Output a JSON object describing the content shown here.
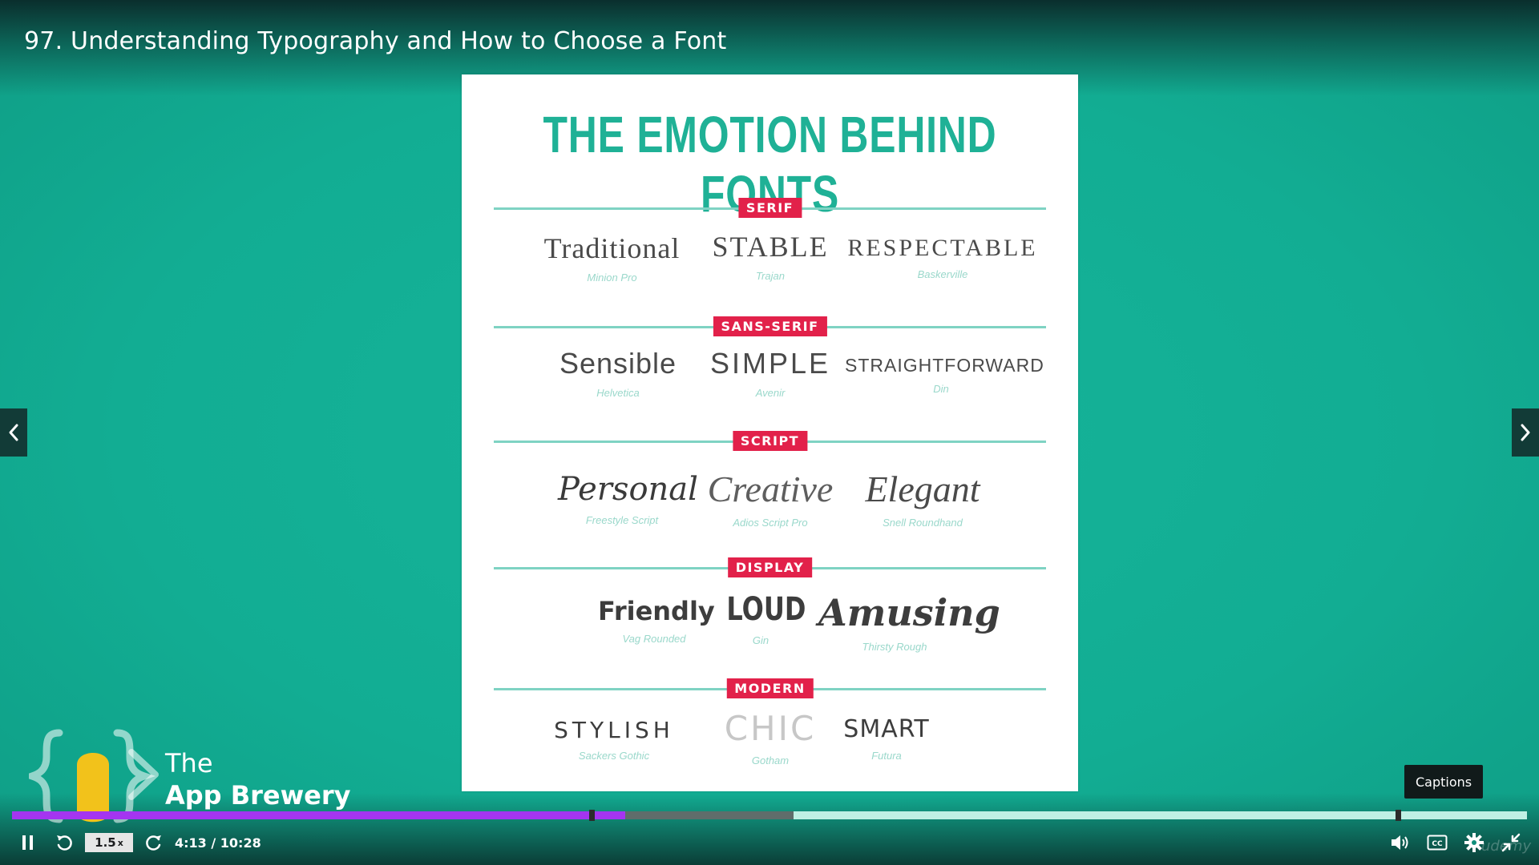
{
  "lecture": {
    "title": "97. Understanding Typography and How to Choose a Font"
  },
  "slide": {
    "heading": "THE EMOTION BEHIND FONTS",
    "sections": [
      {
        "badge": "SERIF",
        "items": [
          {
            "word": "Traditional",
            "font": "Minion Pro"
          },
          {
            "word": "STABLE",
            "font": "Trajan"
          },
          {
            "word": "RESPECTABLE",
            "font": "Baskerville"
          }
        ]
      },
      {
        "badge": "SANS-SERIF",
        "items": [
          {
            "word": "Sensible",
            "font": "Helvetica"
          },
          {
            "word": "SIMPLE",
            "font": "Avenir"
          },
          {
            "word": "STRAIGHTFORWARD",
            "font": "Din"
          }
        ]
      },
      {
        "badge": "SCRIPT",
        "items": [
          {
            "word": "Personal",
            "font": "Freestyle Script"
          },
          {
            "word": "Creative",
            "font": "Adios Script Pro"
          },
          {
            "word": "Elegant",
            "font": "Snell Roundhand"
          }
        ]
      },
      {
        "badge": "DISPLAY",
        "items": [
          {
            "word": "Friendly",
            "font": "Vag Rounded"
          },
          {
            "word": "LOUD",
            "font": "Gin"
          },
          {
            "word": "Amusing",
            "font": "Thirsty Rough"
          }
        ]
      },
      {
        "badge": "MODERN",
        "items": [
          {
            "word": "STYLISH",
            "font": "Sackers Gothic"
          },
          {
            "word": "CHIC",
            "font": "Gotham"
          },
          {
            "word": "SMART",
            "font": "Futura"
          }
        ]
      }
    ]
  },
  "logo": {
    "line1": "The",
    "line2": "App Brewery"
  },
  "tooltip": {
    "text": "Captions"
  },
  "player": {
    "speed": "1.5",
    "speed_suffix": "x",
    "time": "4:13 / 10:28",
    "progress_fraction": 0.405,
    "buffered_fraction": 0.516,
    "bookmark_fractions": [
      0.381,
      0.913
    ],
    "watermark": "udemy"
  },
  "colors": {
    "background": "#14b096",
    "accent_teal": "#1fb196",
    "badge_red": "#e2214a",
    "progress_purple": "#a435f0"
  },
  "icons": {
    "nav_prev": "chevron-left-icon",
    "nav_next": "chevron-right-icon",
    "pause": "pause-icon",
    "rewind": "rewind-5-icon",
    "forward": "forward-5-icon",
    "volume": "volume-icon",
    "captions": "captions-icon",
    "settings": "gear-icon",
    "fullscreen": "exit-fullscreen-icon"
  }
}
